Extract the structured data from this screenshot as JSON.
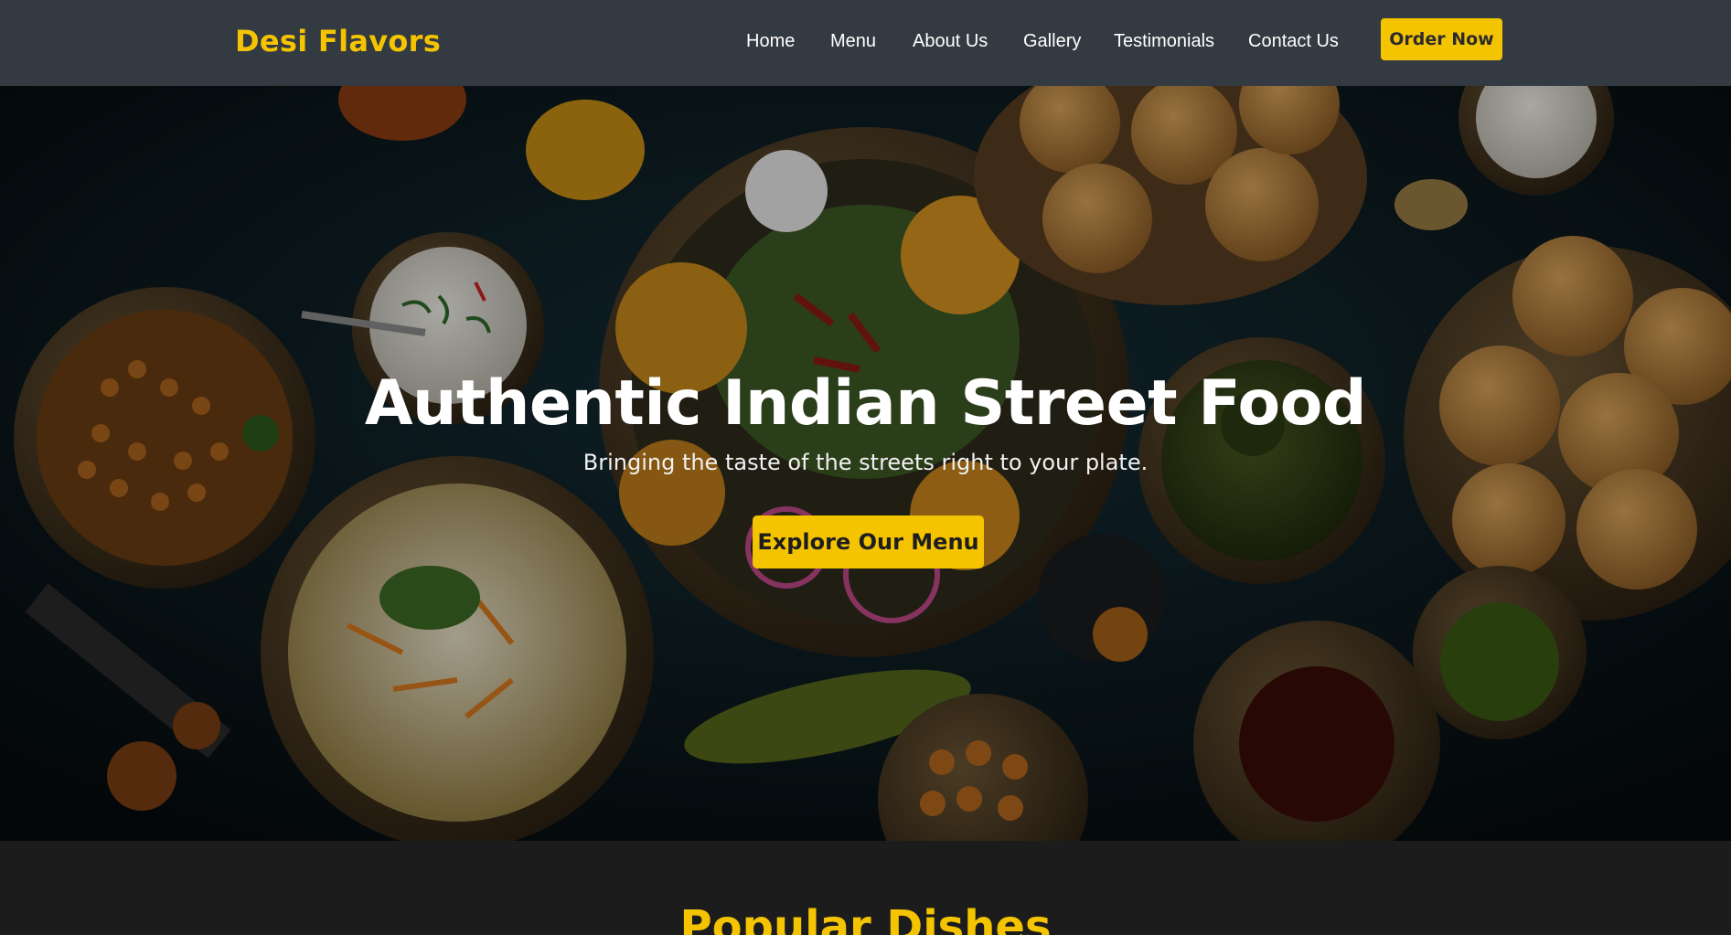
{
  "header": {
    "brand": "Desi Flavors",
    "nav": [
      "Home",
      "Menu",
      "About Us",
      "Gallery",
      "Testimonials",
      "Contact Us"
    ],
    "cta": "Order Now"
  },
  "hero": {
    "title": "Authentic Indian Street Food",
    "subtitle": "Bringing the taste of the streets right to your plate.",
    "button": "Explore Our Menu"
  },
  "popular": {
    "title": "Popular Dishes"
  },
  "colors": {
    "accent": "#f5c400",
    "navbar": "#343a42",
    "page_bg": "#1c1c1c"
  }
}
